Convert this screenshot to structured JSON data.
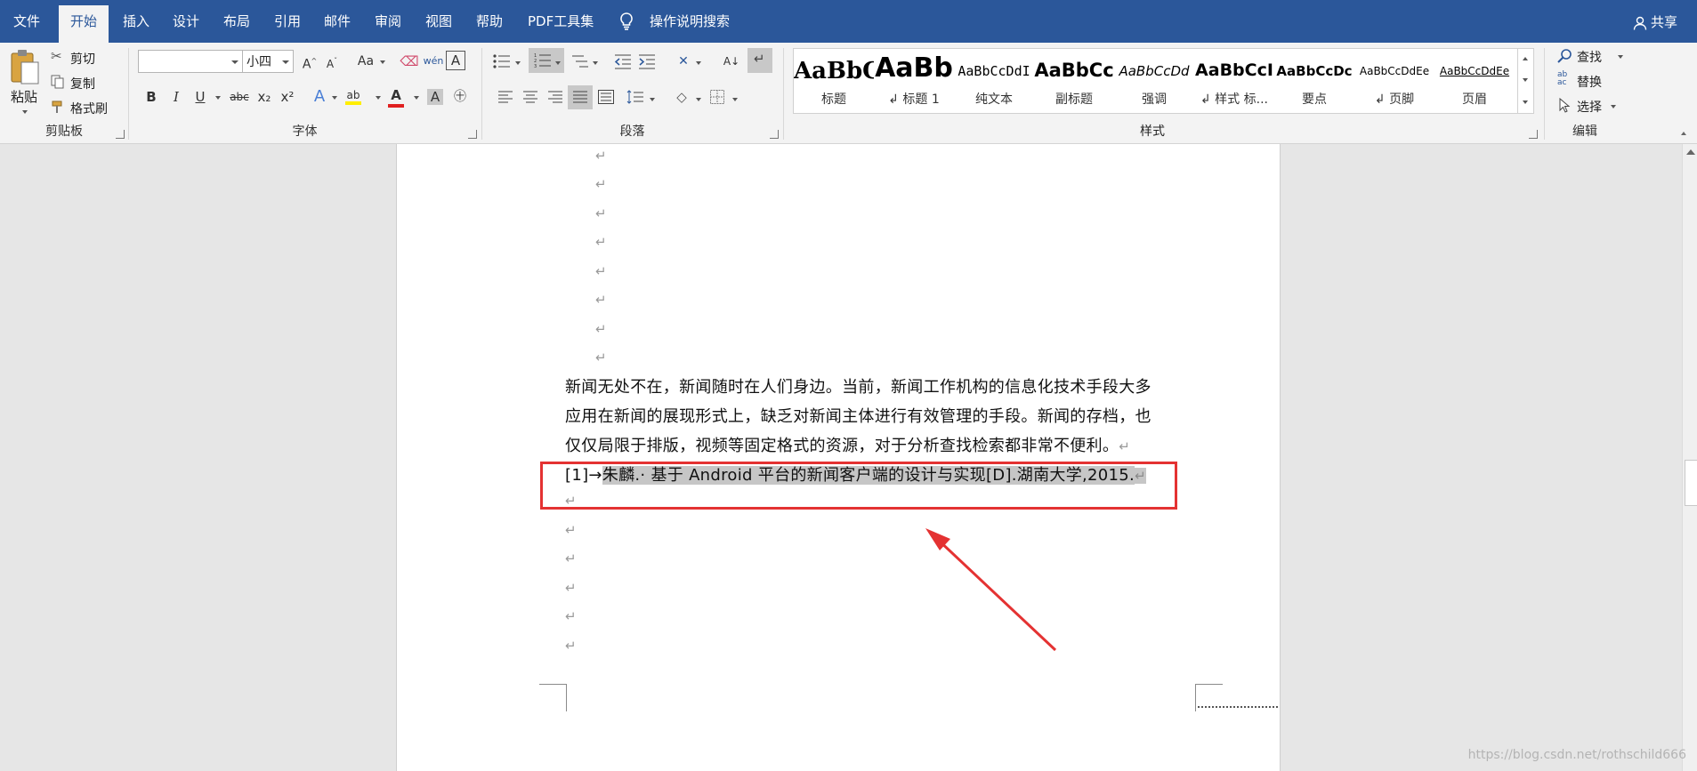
{
  "menu": {
    "tabs": [
      "文件",
      "开始",
      "插入",
      "设计",
      "布局",
      "引用",
      "邮件",
      "审阅",
      "视图",
      "帮助",
      "PDF工具集"
    ],
    "active_tab": "开始",
    "tell_me": "操作说明搜索",
    "share": "共享"
  },
  "ribbon": {
    "clipboard": {
      "label": "剪贴板",
      "paste": "粘贴",
      "cut": "剪切",
      "copy": "复制",
      "format_painter": "格式刷"
    },
    "font": {
      "label": "字体",
      "font_name": "",
      "font_size": "小四",
      "case_btn": "Aa",
      "bold": "B",
      "italic": "I",
      "underline": "U",
      "strike": "abc",
      "subscript": "x₂",
      "superscript": "x²",
      "font_color_letter": "A"
    },
    "paragraph": {
      "label": "段落"
    },
    "styles": {
      "label": "样式",
      "items": [
        {
          "sample": "AaBbC",
          "name": "标题"
        },
        {
          "sample": "AaBb",
          "name": "↲ 标题 1"
        },
        {
          "sample": "AaBbCcDdI",
          "name": "纯文本"
        },
        {
          "sample": "AaBbCc",
          "name": "副标题"
        },
        {
          "sample": "AaBbCcDd",
          "name": "强调"
        },
        {
          "sample": "AaBbCcI",
          "name": "↲ 样式 标..."
        },
        {
          "sample": "AaBbCcDc",
          "name": "要点"
        },
        {
          "sample": "AaBbCcDdEe",
          "name": "↲ 页脚"
        },
        {
          "sample": "AaBbCcDdEe",
          "name": "页眉"
        }
      ]
    },
    "editing": {
      "label": "编辑",
      "find": "查找",
      "replace": "替换",
      "select": "选择"
    }
  },
  "document": {
    "para_mark": "↵",
    "lines": [
      "新闻无处不在，新闻随时在人们身边。当前，新闻工作机构的信息化技术手段大多",
      "应用在新闻的展现形式上，缺乏对新闻主体进行有效管理的手段。新闻的存档，也",
      "仅仅局限于排版，视频等固定格式的资源，对于分析查找检索都非常不便利。"
    ],
    "reference": {
      "prefix": "[1]→",
      "text": "朱麟.· 基于 Android 平台的新闻客户端的设计与实现[D].湖南大学,2015."
    }
  },
  "watermark": "https://blog.csdn.net/rothschild666",
  "colors": {
    "accent": "#2b579a",
    "highlight_box": "#e43232",
    "selection": "#c6c6c6"
  }
}
